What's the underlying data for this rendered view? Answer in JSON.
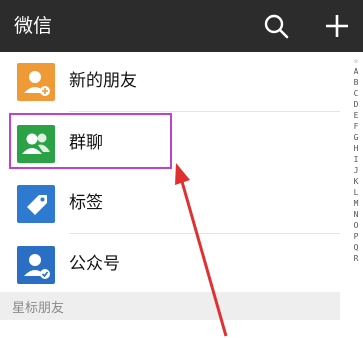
{
  "header": {
    "title": "微信",
    "search_icon": "search-icon",
    "add_icon": "plus-icon"
  },
  "rows": [
    {
      "label": "新的朋友",
      "icon": "add-friend-icon",
      "color": "#f09a37"
    },
    {
      "label": "群聊",
      "icon": "group-chat-icon",
      "color": "#2ba245"
    },
    {
      "label": "标签",
      "icon": "tag-icon",
      "color": "#2f7ad1"
    },
    {
      "label": "公众号",
      "icon": "official-account-icon",
      "color": "#2b6fc4"
    }
  ],
  "section_header": "星标朋友",
  "index_letters": [
    "☆",
    "A",
    "B",
    "C",
    "D",
    "E",
    "F",
    "G",
    "H",
    "I",
    "J",
    "K",
    "L",
    "M",
    "N",
    "O",
    "P",
    "Q",
    "R"
  ],
  "highlight_color": "#c040d0",
  "arrow_color": "#e03030"
}
